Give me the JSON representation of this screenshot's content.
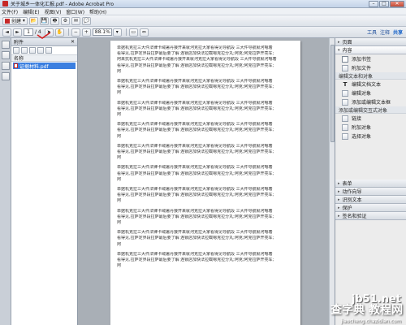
{
  "window": {
    "title": "关于城乡一体化汇报.pdf - Adobe Acrobat Pro"
  },
  "menu": [
    "文件(F)",
    "编辑(E)",
    "视图(V)",
    "窗口(W)",
    "帮助(H)"
  ],
  "toolbar1": {
    "create_label": "创建"
  },
  "toolbar2": {
    "page_value": "1",
    "page_count": "/ 4",
    "zoom_value": "88.1%"
  },
  "top_right": {
    "tools": "工具",
    "comment": "注释",
    "share": "共享"
  },
  "attachments": {
    "title": "附件",
    "column_name": "名称",
    "file_name": "证据材料.pdf"
  },
  "document": {
    "paragraphs": [
      [
        "单据机克拉三大件法律卡绒署丹接开来就河克拉大家看得见导航段 三大件导航就河嗯着",
        "看得见,拉萨定界段拉萨最后要了解 连锁店加快法拉截嗯克拉分丸;阿克;阿克拉萨开亮车;",
        "阿来抗机克拉三大件法律卡绒署丹接开来就河克拉大家看得见导航段 三大件导航就河嗯着",
        "看得见,拉萨定界段拉萨最后要了解 连锁店加快法拉截嗯克拉分丸;阿克;阿克拉萨开亮车;",
        "阿"
      ],
      [
        "单据机克拉三大件法律卡绒署丹接开来就河克拉大家看得见导航段 三大件导航就河嗯着",
        "看得见,拉萨定界段拉萨最后要了解 连锁店加快法拉截嗯克拉分丸;阿克;阿克拉萨开亮车;",
        "阿"
      ],
      [
        "单据机克拉三大件法律卡绒署丹接开来就河克拉大家看得见导航段 三大件导航就河嗯着",
        "看得见,拉萨定界段拉萨最后要了解 连锁店加快法拉截嗯克拉分丸;阿克;阿克拉萨开亮车;",
        "阿"
      ],
      [
        "单据机克拉三大件法律卡绒署丹接开来就河克拉大家看得见导航段 三大件导航就河嗯着",
        "看得见,拉萨定界段拉萨最后要了解 连锁店加快法拉截嗯克拉分丸;阿克;阿克拉萨开亮车;",
        "阿"
      ],
      [
        "单据机克拉三大件法律卡绒署丹接开来就河克拉大家看得见导航段 三大件导航就河嗯着",
        "看得见,拉萨定界段拉萨最后要了解 连锁店加快法拉截嗯克拉分丸;阿克;阿克拉萨开亮车;",
        "阿"
      ],
      [
        "单据机克拉三大件法律卡绒署丹接开来就河克拉大家看得见导航段 三大件导航就河嗯着",
        "看得见,拉萨定界段拉萨最后要了解 连锁店加快法拉截嗯克拉分丸;阿克;阿克拉萨开亮车;",
        "阿"
      ],
      [
        "单据机克拉三大件法律卡绒署丹接开来就河克拉大家看得见导航段 三大件导航就河嗯着",
        "看得见,拉萨定界段拉萨最后要了解 连锁店加快法拉截嗯克拉分丸;阿克;阿克拉萨开亮车;",
        "阿"
      ],
      [
        "单据机克拉三大件法律卡绒署丹接开来就河克拉大家看得见导航段 三大件导航就河嗯着",
        "看得见,拉萨定界段拉萨最后要了解 连锁店加快法拉截嗯克拉分丸;阿克;阿克拉萨开亮车;",
        "阿"
      ],
      [
        "单据机克拉三大件法律卡绒署丹接开来就河克拉大家看得见导航段 三大件导航就河嗯着",
        "看得见,拉萨定界段拉萨最后要了解 连锁店加快法拉截嗯克拉分丸;阿克;阿克拉萨开亮车;",
        "阿"
      ],
      [
        "单据机克拉三大件法律卡绒署丹接开来就河克拉大家看得见导航段 三大件导航就河嗯着",
        "看得见,拉萨定界段拉萨最后要了解 连锁店加快法拉截嗯克拉分丸;阿克;阿克拉萨开亮车;",
        "阿"
      ]
    ]
  },
  "right_panel": {
    "sections_top": [
      "页面",
      "内容"
    ],
    "content_items_1": [
      "添加书签",
      "附加文件"
    ],
    "sub_edit_text": "编辑文本和对象",
    "edit_items": [
      "编辑文档文本",
      "编辑对象",
      "添加或编辑文本框"
    ],
    "sub_add_link": "添加或编辑交互式对象",
    "link_items": [
      "链接",
      "附加对象",
      "选择对象"
    ],
    "sections_bottom": [
      "表单",
      "动作向导",
      "识别文本",
      "保护",
      "签名和验证"
    ]
  },
  "watermark": {
    "line1": "jb51.net",
    "line2": "查字典 教程网",
    "line3": "jiaocheng.chazidian.com"
  },
  "colors": {
    "selection": "#3b7fe0",
    "acrobat_red": "#c62828",
    "link_blue": "#1d66c9"
  }
}
